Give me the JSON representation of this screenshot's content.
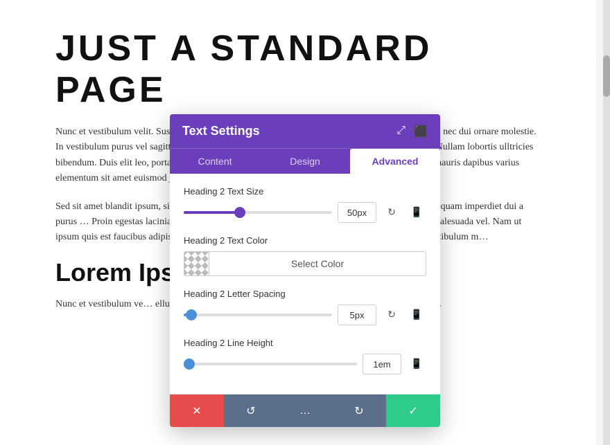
{
  "page": {
    "title": "JUST A STANDARD PAGE",
    "body1": "Nunc et vestibulum velit. Suspendisse euismod eros vel urna bibendum gravida. Phasellus et metus nec dui ornare molestie. In vestibulum purus vel sagittis aliquet. Aenean sapien nibh, feugiat non arcu, at tincidunt sapien. Nullam lobortis ulltricies bibendum. Duis elit leo, porta vel nisl in, ullamcorper scelerisque velit. Fusce volutpat purus d… mauris dapibus varius elementum sit amet euismod justo.",
    "body2": "Sed sit amet blandit ipsum, sit amet vestibulum risus. Morbi vitae odio ut ante molestie semper. Aliquam imperdiet dui a purus … Proin egestas lacinia nec sit amet dui. Cras m… massa mauris, bibendum a mollis a, la… alesuada vel. Nam ut ipsum quis est faucibus adipiscing elit. Maecenas nunc felis, v… um dolor at varius. Fusce sed vestibulum m…",
    "section_heading": "Lorem Ipsum D…",
    "body3": "Nunc et vestibulum ve… ellus et metus nec dui ornare molestie. In… ullamcorper scelerisque velit."
  },
  "panel": {
    "title": "Text Settings",
    "tabs": [
      {
        "label": "Content",
        "active": false
      },
      {
        "label": "Design",
        "active": false
      },
      {
        "label": "Advanced",
        "active": true
      }
    ],
    "settings": [
      {
        "label": "Heading 2 Text Size",
        "type": "slider",
        "value": "50px",
        "slider_percent": 38,
        "thumb_color": "purple"
      },
      {
        "label": "Heading 2 Text Color",
        "type": "color",
        "btn_label": "Select Color"
      },
      {
        "label": "Heading 2 Letter Spacing",
        "type": "slider",
        "value": "5px",
        "slider_percent": 5,
        "thumb_color": "blue"
      },
      {
        "label": "Heading 2 Line Height",
        "type": "slider",
        "value": "1em",
        "slider_percent": 3,
        "thumb_color": "blue"
      }
    ],
    "footer_buttons": [
      {
        "id": "cancel",
        "icon": "✕",
        "color": "#e74c4c"
      },
      {
        "id": "undo",
        "icon": "↺",
        "color": "#5b6e8c"
      },
      {
        "id": "more",
        "icon": "…",
        "color": "#5b6e8c"
      },
      {
        "id": "redo",
        "icon": "↻",
        "color": "#5b6e8c"
      },
      {
        "id": "confirm",
        "icon": "✓",
        "color": "#2ecc8a"
      }
    ],
    "header_icons": [
      {
        "id": "resize-icon",
        "symbol": "⤢"
      },
      {
        "id": "grid-icon",
        "symbol": "⬛"
      }
    ]
  }
}
